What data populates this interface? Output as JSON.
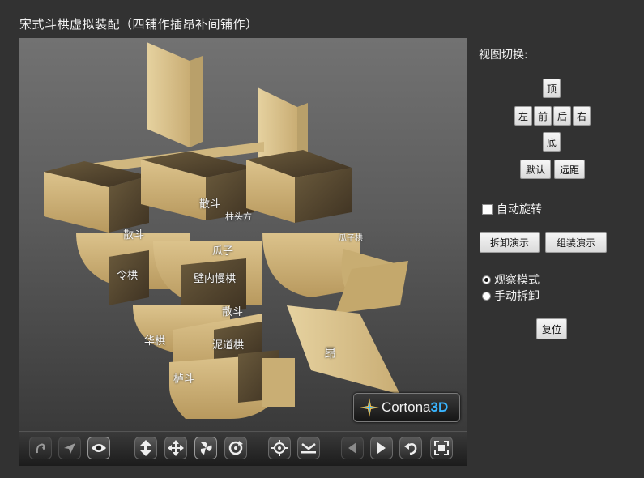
{
  "page": {
    "title": "宋式斗栱虚拟装配（四铺作插昂补间铺作）"
  },
  "viewport": {
    "labels": [
      "散斗",
      "令栱",
      "华栱",
      "栌斗",
      "散斗",
      "壁内慢栱",
      "泥道栱",
      "散斗",
      "瓜子",
      "瓜子栱",
      "柱头方",
      "昂"
    ],
    "badge": {
      "brand": "Cortona",
      "suffix": "3D"
    }
  },
  "toolbar": {
    "icons": [
      "walk-icon",
      "fly-icon",
      "study-icon",
      "pan-vertical-icon",
      "plane-icon",
      "turn-icon",
      "rotate-icon",
      "goto-icon",
      "align-icon",
      "prev-view-icon",
      "next-view-icon",
      "restore-icon",
      "fit-icon"
    ]
  },
  "panel": {
    "view_switch_title": "视图切换:",
    "views": {
      "top": "顶",
      "left": "左",
      "front": "前",
      "back": "后",
      "right": "右",
      "bottom": "底",
      "default": "默认",
      "far": "远距"
    },
    "auto_rotate": {
      "label": "自动旋转",
      "checked": false
    },
    "disassemble_demo": "拆卸演示",
    "assemble_demo": "组装演示",
    "modes": [
      {
        "label": "观察模式",
        "selected": true
      },
      {
        "label": "手动拆卸",
        "selected": false
      }
    ],
    "reset": "复位"
  },
  "colors": {
    "background": "#323232",
    "wood": "#d8c08a",
    "wood_dark": "#5a4a30",
    "accent": "#39b5ff"
  }
}
